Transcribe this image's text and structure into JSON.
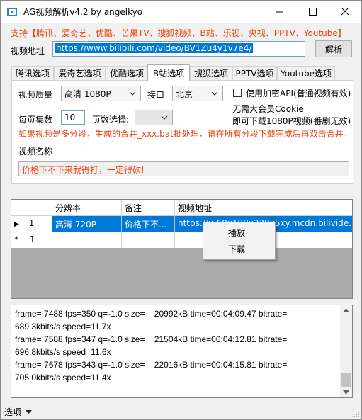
{
  "window": {
    "title": "AG视频解析v4.2 by angelkyo",
    "controls": [
      "minimize",
      "maximize",
      "close"
    ]
  },
  "support_text": "支持【腾讯、爱奇艺、优酷、芒果TV、搜狐视频、B站、乐视、央视、PPTV、Youtube】",
  "url": {
    "label": "视频地址",
    "value": "https://www.bilibili.com/video/BV1Zu4y1v7e4/",
    "parse_button": "解析"
  },
  "tabs": [
    {
      "label": "腾讯选项",
      "active": false
    },
    {
      "label": "爱奇艺选项",
      "active": false
    },
    {
      "label": "优酷选项",
      "active": false
    },
    {
      "label": "B站选项",
      "active": true
    },
    {
      "label": "搜狐选项",
      "active": false
    },
    {
      "label": "PPTV选项",
      "active": false
    },
    {
      "label": "Youtube选项",
      "active": false
    }
  ],
  "bilibili_panel": {
    "quality_label": "视频质量",
    "quality_value": "高清 1080P",
    "api_label": "接口",
    "api_value": "北京",
    "encrypt_label": "使用加密API(普通视频有效)",
    "encrypt_checked": false,
    "per_page_label": "每页集数",
    "per_page_value": "10",
    "page_select_label": "页数选择:",
    "page_select_value": "",
    "cookie_line1": "无需大会员Cookie",
    "cookie_line2": "即可下载1080P视频(番剧无效)",
    "multi_segment_note": "如果视频是多分段，生成的合并_xxx.bat批处理，请在所有分段下载完成后再双击合并。"
  },
  "video_name": {
    "label": "视频名称",
    "value": "价格下不下来就得打，一定得砍!"
  },
  "grid": {
    "columns": [
      "",
      "分辨率",
      "备注",
      "视频地址"
    ],
    "rows": [
      {
        "marker": "▶",
        "index": "1",
        "resolution": "高清 720P",
        "note": "价格下不...",
        "url": "https://x-60x188x229x5xy.mcdn.bilivide..."
      },
      {
        "marker": "*",
        "index": "1",
        "resolution": "",
        "note": "",
        "url": ""
      }
    ]
  },
  "context_menu": {
    "items": [
      "播放",
      "下载"
    ]
  },
  "log": {
    "lines": [
      "frame= 7488 fps=350 q=-1.0 size=    20992kB time=00:04:09.47 bitrate=",
      "689.3kbits/s speed=11.7x",
      "frame= 7588 fps=347 q=-1.0 size=    21504kB time=00:04:12.81 bitrate=",
      "696.8kbits/s speed=11.6x",
      "frame= 7678 fps=343 q=-1.0 size=    22016kB time=00:04:15.81 bitrate=",
      "705.0kbits/s speed=11.4x"
    ]
  },
  "status": {
    "options_label": "选项"
  },
  "colors": {
    "accent": "#0078d7",
    "warning_text": "#e8420c"
  }
}
